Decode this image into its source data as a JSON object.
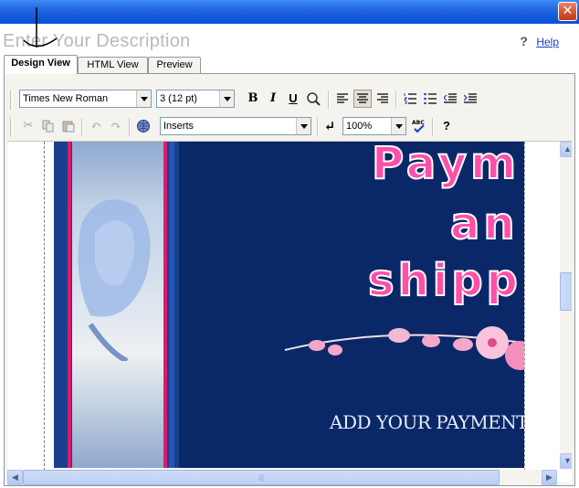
{
  "window": {
    "close_glyph": "✕"
  },
  "header": {
    "title": "Enter Your Description",
    "help_icon": "?",
    "help_label": "Help"
  },
  "tabs": [
    {
      "label": "Design View",
      "active": true
    },
    {
      "label": "HTML View",
      "active": false
    },
    {
      "label": "Preview",
      "active": false
    }
  ],
  "toolbar": {
    "font_family": "Times New Roman",
    "font_size": "3 (12 pt)",
    "bold": "B",
    "italic": "I",
    "underline": "U",
    "inserts": "Inserts",
    "zoom": "100%",
    "help": "?",
    "enter_glyph": "↵",
    "spell_abc": "ABC"
  },
  "content": {
    "banner_line1": "Paym",
    "banner_line2": "an",
    "banner_line3": "shipp",
    "banner_footer": "ADD YOUR PAYMENT AND S"
  },
  "icons": [
    "close-icon",
    "help-icon",
    "bold-icon",
    "italic-icon",
    "underline-icon",
    "highlight-icon",
    "align-left-icon",
    "align-center-icon",
    "align-right-icon",
    "numbered-list-icon",
    "bulleted-list-icon",
    "outdent-icon",
    "indent-icon",
    "cut-icon",
    "copy-icon",
    "paste-icon",
    "undo-icon",
    "redo-icon",
    "globe-icon",
    "enter-icon",
    "spellcheck-icon"
  ],
  "colors": {
    "titlebar": "#0a4fd6",
    "banner_bg": "#0a2868",
    "banner_text": "#ff4fa8",
    "link": "#1a3cc4"
  }
}
